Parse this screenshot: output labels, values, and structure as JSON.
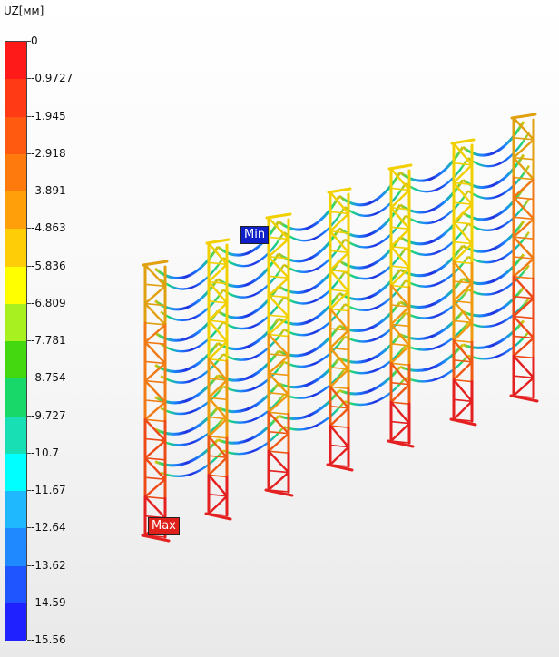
{
  "legend": {
    "title": "UZ[мм]",
    "labels": [
      "0",
      "-0.9727",
      "-1.945",
      "-2.918",
      "-3.891",
      "-4.863",
      "-5.836",
      "-6.809",
      "-7.781",
      "-8.754",
      "-9.727",
      "-10.7",
      "-11.67",
      "-12.64",
      "-13.62",
      "-14.59",
      "-15.56"
    ],
    "colors": [
      "#ff1a1a",
      "#ff3a14",
      "#ff5a10",
      "#ff7a0c",
      "#ff9f0a",
      "#ffcc08",
      "#ffff00",
      "#a8f020",
      "#44d810",
      "#18d86a",
      "#18e0b4",
      "#00ffff",
      "#1fb8ff",
      "#1f8aff",
      "#1f55ff",
      "#1f22ff"
    ]
  },
  "markers": {
    "min_label": "Min",
    "max_label": "Max"
  }
}
